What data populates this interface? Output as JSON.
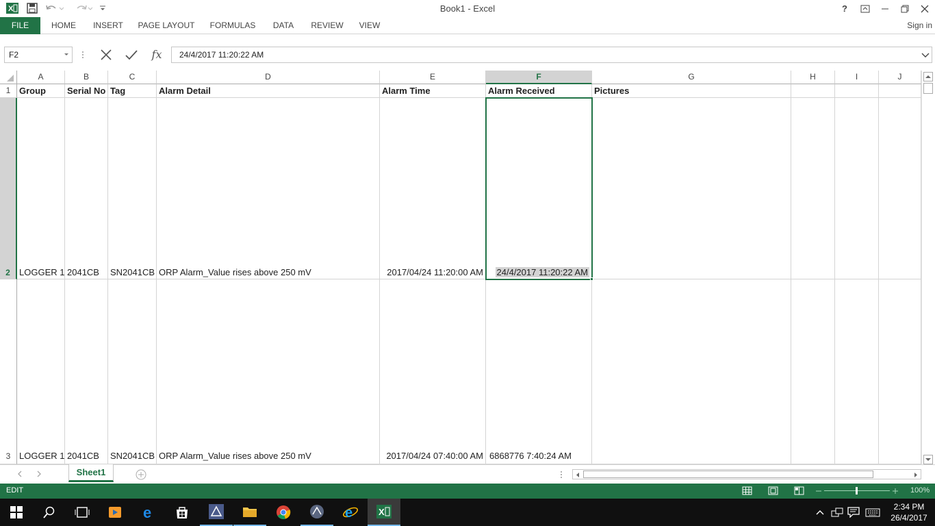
{
  "window": {
    "title": "Book1 - Excel",
    "help": "?",
    "sign_in": "Sign in"
  },
  "ribbon": {
    "tabs": [
      "FILE",
      "HOME",
      "INSERT",
      "PAGE LAYOUT",
      "FORMULAS",
      "DATA",
      "REVIEW",
      "VIEW"
    ]
  },
  "formula_bar": {
    "name_box": "F2",
    "fx": "fx",
    "value": "24/4/2017  11:20:22 AM"
  },
  "columns": [
    "A",
    "B",
    "C",
    "D",
    "E",
    "F",
    "G",
    "H",
    "I",
    "J"
  ],
  "selected_column": "F",
  "rows": [
    {
      "num": "1",
      "cells": [
        "Group",
        "Serial No",
        "Tag",
        "Alarm Detail",
        "Alarm Time",
        "Alarm Received",
        "Pictures"
      ]
    },
    {
      "num": "2",
      "cells": [
        "LOGGER 1",
        "2041CB",
        "SN2041CB",
        "ORP Alarm_Value rises above 250 mV",
        "2017/04/24 11:20:00 AM",
        "24/4/2017  11:20:22 AM",
        ""
      ]
    },
    {
      "num": "3",
      "cells": [
        "LOGGER 1",
        "2041CB",
        "SN2041CB",
        "ORP Alarm_Value rises above 250 mV",
        "2017/04/24 07:40:00 AM",
        "6868776  7:40:24 AM",
        ""
      ]
    }
  ],
  "sheet_tabs": [
    "Sheet1"
  ],
  "status": {
    "mode": "EDIT",
    "zoom": "100%"
  },
  "taskbar": {
    "time": "2:34 PM",
    "date": "26/4/2017"
  },
  "colors": {
    "accent": "#217346",
    "taskbar": "#101010",
    "selection": "#d3d3d3"
  }
}
